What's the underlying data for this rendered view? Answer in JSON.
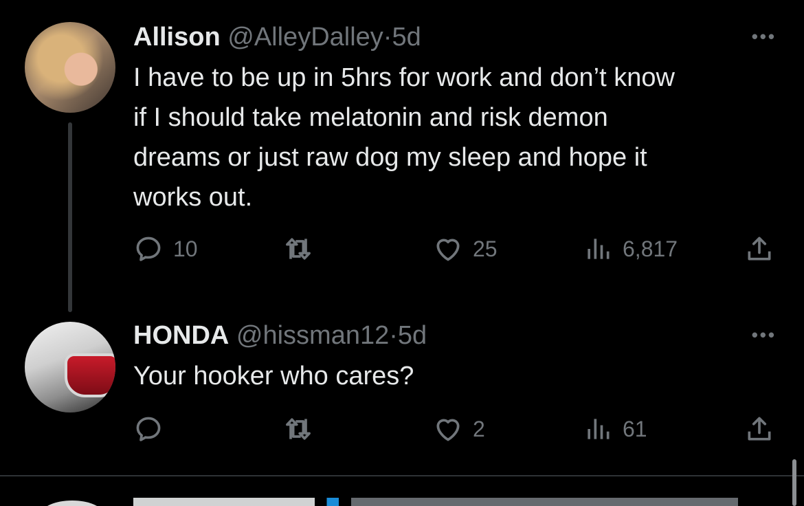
{
  "tweets": [
    {
      "name": "Allison",
      "handle": "@AlleyDalley",
      "separator": "·",
      "time": "5d",
      "more": "•••",
      "lines": [
        "I have to be up in 5hrs for work and don’t know",
        "if I should take melatonin and risk demon",
        "dreams or just raw dog my sleep and hope it",
        "works out."
      ],
      "replies": "10",
      "retweets": "",
      "likes": "25",
      "views": "6,817"
    },
    {
      "name": "HONDA",
      "handle": "@hissman12",
      "separator": "·",
      "time": "5d",
      "more": "•••",
      "lines": [
        "Your hooker who cares?"
      ],
      "replies": "",
      "retweets": "",
      "likes": "2",
      "views": "61"
    }
  ],
  "icons": {
    "reply": "reply-icon",
    "retweet": "retweet-icon",
    "like": "heart-icon",
    "views": "views-icon",
    "share": "share-icon"
  },
  "colors": {
    "background": "#000000",
    "text": "#e7e9ea",
    "secondary": "#71767b",
    "divider": "#2f3336"
  }
}
